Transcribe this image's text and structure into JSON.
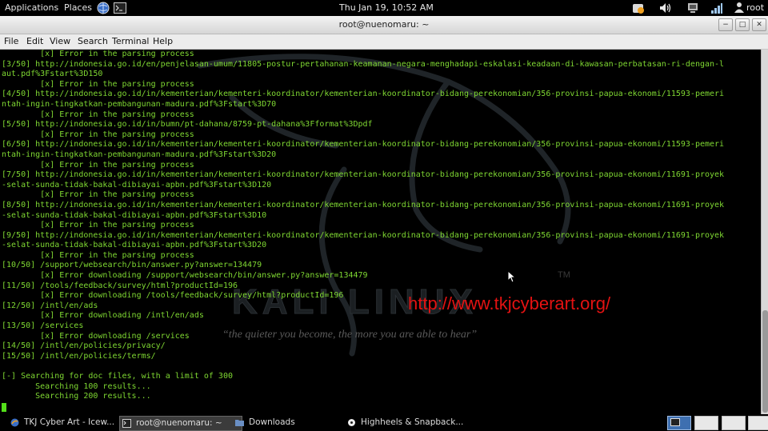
{
  "top_panel": {
    "applications": "Applications",
    "places": "Places",
    "clock": "Thu Jan 19, 10:52 AM",
    "user": "root"
  },
  "window": {
    "title": "root@nuenomaru: ~"
  },
  "menu": [
    "File",
    "Edit",
    "View",
    "Search",
    "Terminal",
    "Help"
  ],
  "terminal": {
    "lines": [
      "        [x] Error in the parsing process",
      "[3/50] http://indonesia.go.id/en/penjelasan-umum/11805-postur-pertahanan-keamanan-negara-menghadapi-eskalasi-keadaan-di-kawasan-perbatasan-ri-dengan-l",
      "aut.pdf%3Fstart%3D150",
      "        [x] Error in the parsing process",
      "[4/50] http://indonesia.go.id/in/kementerian/kementeri-koordinator/kementerian-koordinator-bidang-perekonomian/356-provinsi-papua-ekonomi/11593-pemeri",
      "ntah-ingin-tingkatkan-pembangunan-madura.pdf%3Fstart%3D70",
      "        [x] Error in the parsing process",
      "[5/50] http://indonesia.go.id/in/bumn/pt-dahana/8759-pt-dahana%3Fformat%3Dpdf",
      "        [x] Error in the parsing process",
      "[6/50] http://indonesia.go.id/in/kementerian/kementeri-koordinator/kementerian-koordinator-bidang-perekonomian/356-provinsi-papua-ekonomi/11593-pemeri",
      "ntah-ingin-tingkatkan-pembangunan-madura.pdf%3Fstart%3D20",
      "        [x] Error in the parsing process",
      "[7/50] http://indonesia.go.id/in/kementerian/kementeri-koordinator/kementerian-koordinator-bidang-perekonomian/356-provinsi-papua-ekonomi/11691-proyek",
      "-selat-sunda-tidak-bakal-dibiayai-apbn.pdf%3Fstart%3D120",
      "        [x] Error in the parsing process",
      "[8/50] http://indonesia.go.id/in/kementerian/kementeri-koordinator/kementerian-koordinator-bidang-perekonomian/356-provinsi-papua-ekonomi/11691-proyek",
      "-selat-sunda-tidak-bakal-dibiayai-apbn.pdf%3Fstart%3D10",
      "        [x] Error in the parsing process",
      "[9/50] http://indonesia.go.id/in/kementerian/kementeri-koordinator/kementerian-koordinator-bidang-perekonomian/356-provinsi-papua-ekonomi/11691-proyek",
      "-selat-sunda-tidak-bakal-dibiayai-apbn.pdf%3Fstart%3D20",
      "        [x] Error in the parsing process",
      "[10/50] /support/websearch/bin/answer.py?answer=134479",
      "        [x] Error downloading /support/websearch/bin/answer.py?answer=134479",
      "[11/50] /tools/feedback/survey/html?productId=196",
      "        [x] Error downloading /tools/feedback/survey/html?productId=196",
      "[12/50] /intl/en/ads",
      "        [x] Error downloading /intl/en/ads",
      "[13/50] /services",
      "        [x] Error downloading /services",
      "[14/50] /intl/en/policies/privacy/",
      "[15/50] /intl/en/policies/terms/",
      "",
      "[-] Searching for doc files, with a limit of 300",
      "       Searching 100 results...",
      "       Searching 200 results..."
    ]
  },
  "wallpaper": {
    "logo_text": "KALI LINUX",
    "trademark": "TM",
    "tagline": "“the quieter you become, the more you are able to hear”"
  },
  "watermark_url": "http://www.tkjcyberart.org/",
  "taskbar": {
    "tasks": [
      "TKJ Cyber Art - Icew...",
      "root@nuenomaru: ~",
      "Downloads",
      "Highheels & Snapback..."
    ]
  },
  "colors": {
    "terminal_text": "#7fd832",
    "watermark": "#e41212"
  }
}
